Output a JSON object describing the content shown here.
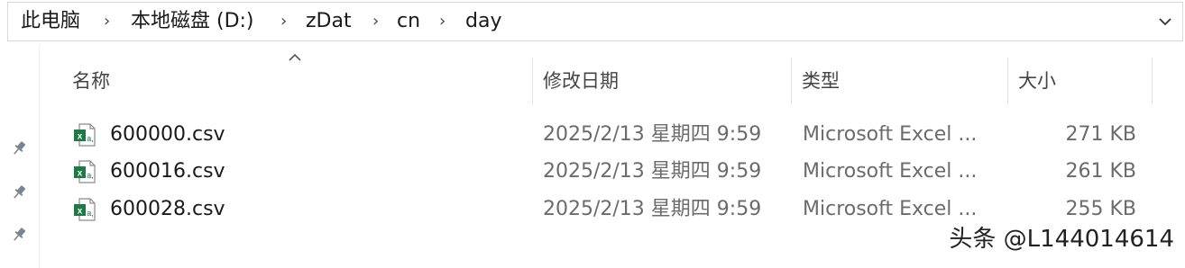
{
  "breadcrumb": {
    "items": [
      "此电脑",
      "本地磁盘 (D:)",
      "zDat",
      "cn",
      "day"
    ]
  },
  "columns": {
    "name": "名称",
    "modified": "修改日期",
    "type": "类型",
    "size": "大小"
  },
  "files": [
    {
      "name": "600000.csv",
      "modified": "2025/2/13 星期四 9:59",
      "type": "Microsoft Excel ...",
      "size": "271 KB"
    },
    {
      "name": "600016.csv",
      "modified": "2025/2/13 星期四 9:59",
      "type": "Microsoft Excel ...",
      "size": "261 KB"
    },
    {
      "name": "600028.csv",
      "modified": "2025/2/13 星期四 9:59",
      "type": "Microsoft Excel ...",
      "size": "255 KB"
    }
  ],
  "watermark": "头条 @L144014614",
  "icons": {
    "breadcrumb_separator": "chevron-right-icon",
    "address_dropdown": "chevron-down-icon",
    "sort": "sort-ascending-icon",
    "file": "excel-csv-file-icon",
    "pin": "pin-icon"
  },
  "colors": {
    "excel_green": "#1d7a45",
    "header_text": "#444444",
    "muted_text": "#6b6b6b"
  }
}
